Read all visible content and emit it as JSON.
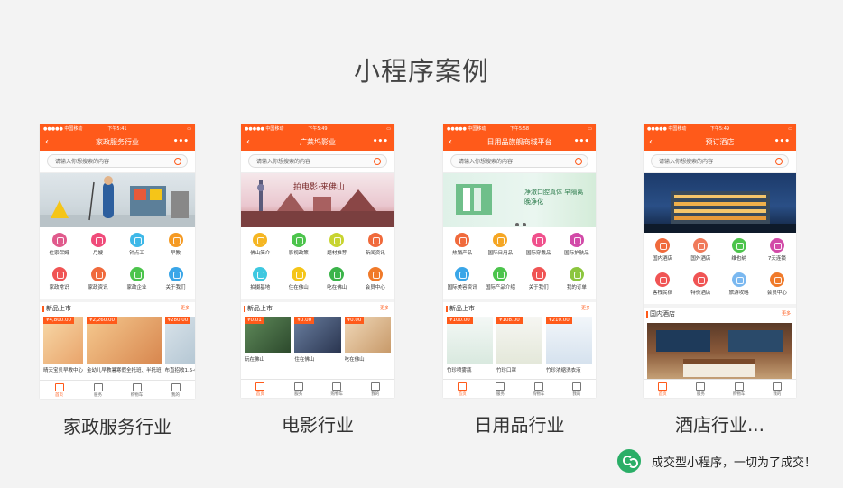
{
  "page": {
    "title": "小程序案例",
    "footer_text": "成交型小程序，一切为了成交！",
    "accent": "#ff5a1a",
    "brand_green": "#2aae67"
  },
  "phones": [
    {
      "status_left": "●●●●● 中国移动",
      "status_time": "下午5:41",
      "nav_title": "家政服务行业",
      "search_placeholder": "请输入你想搜索的内容",
      "icons": [
        {
          "label": "住家保姆",
          "color": "#e05a8c"
        },
        {
          "label": "月嫂",
          "color": "#f04b7a"
        },
        {
          "label": "钟点工",
          "color": "#3eb8e8"
        },
        {
          "label": "早教",
          "color": "#f59a23"
        },
        {
          "label": "家政常识",
          "color": "#f05454"
        },
        {
          "label": "家政资讯",
          "color": "#f06a3c"
        },
        {
          "label": "家政企业",
          "color": "#4cc44c"
        },
        {
          "label": "关于我们",
          "color": "#3aa6e8"
        }
      ],
      "section": "新品上市",
      "more": "更多",
      "products": [
        {
          "price": "¥4,800.00",
          "name": "晴天宝贝早教中心"
        },
        {
          "price": "¥2,260.00",
          "name": "金幼儿早教暑寒假全托班、半托班"
        },
        {
          "price": "¥280.00",
          "name": "布直招收1.5-6岁幼儿托管寒暑托..."
        }
      ],
      "tabs": [
        "首页",
        "服务",
        "购物车",
        "我的"
      ],
      "caption": "家政服务行业"
    },
    {
      "status_left": "●●●●● 中国移动",
      "status_time": "下午5:49",
      "nav_title": "广莱坞影业",
      "search_placeholder": "请输入你想搜索的内容",
      "icons": [
        {
          "label": "佛山简介",
          "color": "#f5b623"
        },
        {
          "label": "影视政策",
          "color": "#4cc44c"
        },
        {
          "label": "题材推荐",
          "color": "#c8d430"
        },
        {
          "label": "新闻资讯",
          "color": "#f06a3c"
        },
        {
          "label": "拍摄基地",
          "color": "#3ec8e0"
        },
        {
          "label": "住在佛山",
          "color": "#f5c518"
        },
        {
          "label": "吃在佛山",
          "color": "#3bb44a"
        },
        {
          "label": "会员中心",
          "color": "#f07a2a"
        }
      ],
      "section": "新品上市",
      "more": "更多",
      "products": [
        {
          "price": "¥0.01",
          "name": "玩在佛山"
        },
        {
          "price": "¥0.00",
          "name": "住在佛山"
        },
        {
          "price": "¥0.00",
          "name": "吃在佛山"
        }
      ],
      "tabs": [
        "首页",
        "服务",
        "购物车",
        "我的"
      ],
      "caption": "电影行业"
    },
    {
      "status_left": "●●●●● 中国移动",
      "status_time": "下午5:58",
      "nav_title": "日用品旗舰商城平台",
      "search_placeholder": "请输入你想搜索的内容",
      "banner_text": "净澈口腔真体  早隔离 晚净化",
      "icons": [
        {
          "label": "热销产品",
          "color": "#f06a3c"
        },
        {
          "label": "国际日用品",
          "color": "#f5a623"
        },
        {
          "label": "国际穿戴品",
          "color": "#f0508c"
        },
        {
          "label": "国际护肤品",
          "color": "#d24aa8"
        },
        {
          "label": "国际美容资讯",
          "color": "#3aa6e8"
        },
        {
          "label": "国际产品介绍",
          "color": "#4cc44c"
        },
        {
          "label": "关于我们",
          "color": "#f05454"
        },
        {
          "label": "我的订单",
          "color": "#8cc63e"
        }
      ],
      "section": "新品上市",
      "more": "更多",
      "products": [
        {
          "price": "¥100.00",
          "name": "竹珍喷雾瓶"
        },
        {
          "price": "¥108.00",
          "name": "竹珍口罩"
        },
        {
          "price": "¥210.00",
          "name": "竹珍浓缩洗衣液"
        }
      ],
      "tabs": [
        "首页",
        "服务",
        "购物车",
        "我的"
      ],
      "caption": "日用品行业"
    },
    {
      "status_left": "●●●●● 中国移动",
      "status_time": "下午5:49",
      "nav_title": "预订酒店",
      "search_placeholder": "请输入你想搜索的内容",
      "icons": [
        {
          "label": "国内酒店",
          "color": "#f06a3c"
        },
        {
          "label": "国外酒店",
          "color": "#f07a5a"
        },
        {
          "label": "维也纳",
          "color": "#4cc44c"
        },
        {
          "label": "7天连锁",
          "color": "#d24aa8"
        },
        {
          "label": "客栈民宿",
          "color": "#f05454"
        },
        {
          "label": "特价酒店",
          "color": "#f05454"
        },
        {
          "label": "旅游攻略",
          "color": "#7ab8f0"
        },
        {
          "label": "会员中心",
          "color": "#f07a2a"
        }
      ],
      "section": "国内酒店",
      "more": "更多",
      "tabs": [
        "首页",
        "服务",
        "购物车",
        "我的"
      ],
      "caption": "酒店行业..."
    }
  ]
}
